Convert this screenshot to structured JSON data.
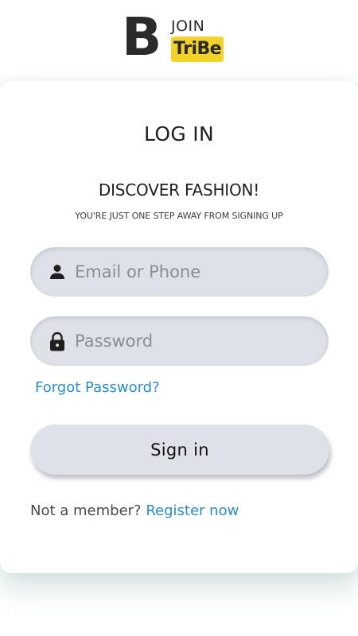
{
  "logo": {
    "letter": "B",
    "join": "JOIN",
    "tribe": "TriBe",
    "accent_color": "#f3d22a"
  },
  "login": {
    "title": "LOG IN",
    "headline": "DISCOVER FASHION!",
    "tagline": "YOU'RE JUST ONE STEP AWAY FROM SIGNING UP",
    "email": {
      "placeholder": "Email or Phone",
      "value": "",
      "icon": "user-icon"
    },
    "password": {
      "placeholder": "Password",
      "value": "",
      "icon": "lock-icon"
    },
    "forgot_label": "Forgot Password?",
    "signin_label": "Sign in",
    "register_prompt": "Not a member?",
    "register_label": "Register now",
    "link_color": "#2a8cc8",
    "field_color": "#dfe1e9"
  }
}
